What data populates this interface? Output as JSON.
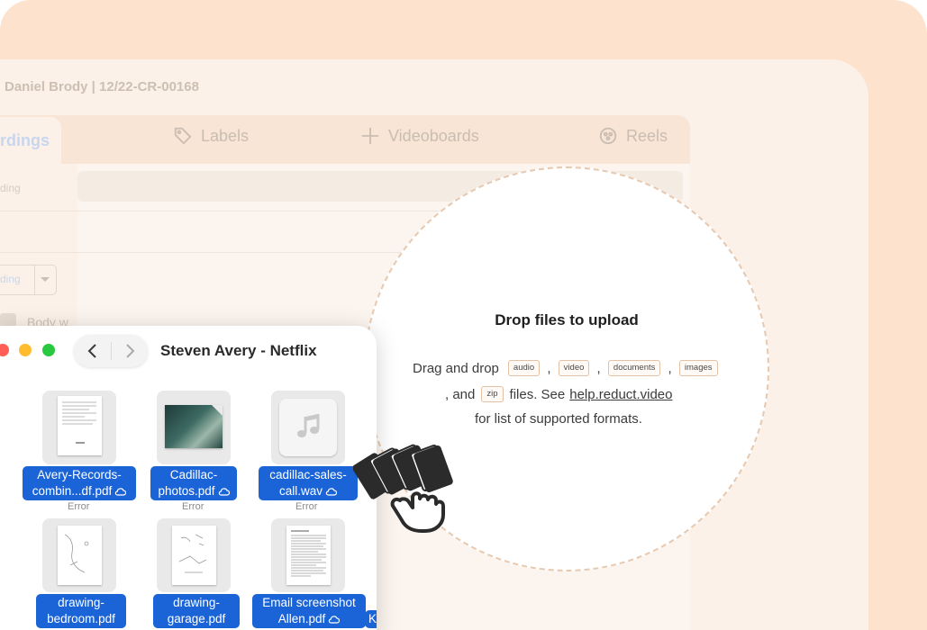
{
  "app": {
    "title": "Daniel Brody | 12/22-CR-00168",
    "tabs": [
      {
        "label": "rdings",
        "active": true
      },
      {
        "label": "Labels",
        "icon": "tag-icon"
      },
      {
        "label": "Videoboards",
        "icon": "plus-icon"
      },
      {
        "label": "Reels",
        "icon": "reel-icon"
      }
    ],
    "left_panel": {
      "sort_text": "ding",
      "dropdown_label": "ding",
      "body_label": "Body w"
    }
  },
  "drop_zone": {
    "title": "Drop files to upload",
    "line1_prefix": "Drag and drop",
    "chips": [
      "audio",
      "video",
      "documents",
      "images",
      "zip"
    ],
    "line2_and": ", and",
    "line2_files": "files. See",
    "help_link": "help.reduct.video",
    "line3": "for list of supported formats."
  },
  "finder": {
    "title": "Steven Avery - Netflix",
    "files": [
      {
        "name_line1": "Avery-Records-",
        "name_line2": "combin...df.pdf",
        "status": "Error",
        "cloud": true
      },
      {
        "name_line1": "Cadillac-",
        "name_line2": "photos.pdf",
        "status": "Error",
        "cloud": true
      },
      {
        "name_line1": "cadillac-sales-",
        "name_line2": "call.wav",
        "status": "Error",
        "cloud": true
      },
      {
        "name_line1": "drawing-",
        "name_line2": "bedroom.pdf",
        "status": "",
        "cloud": false
      },
      {
        "name_line1": "drawing-",
        "name_line2": "garage.pdf",
        "status": "",
        "cloud": false
      },
      {
        "name_line1": "Email screenshot",
        "name_line2": "Allen.pdf",
        "status": "",
        "cloud": true
      },
      {
        "name_line1": "K",
        "name_line2": "",
        "status": "",
        "cloud": false
      }
    ]
  },
  "colors": {
    "background": "#fde2cd",
    "selection": "#1a64d8",
    "traffic_red": "#ff5f57",
    "traffic_yellow": "#febc2e",
    "traffic_green": "#28c840"
  }
}
